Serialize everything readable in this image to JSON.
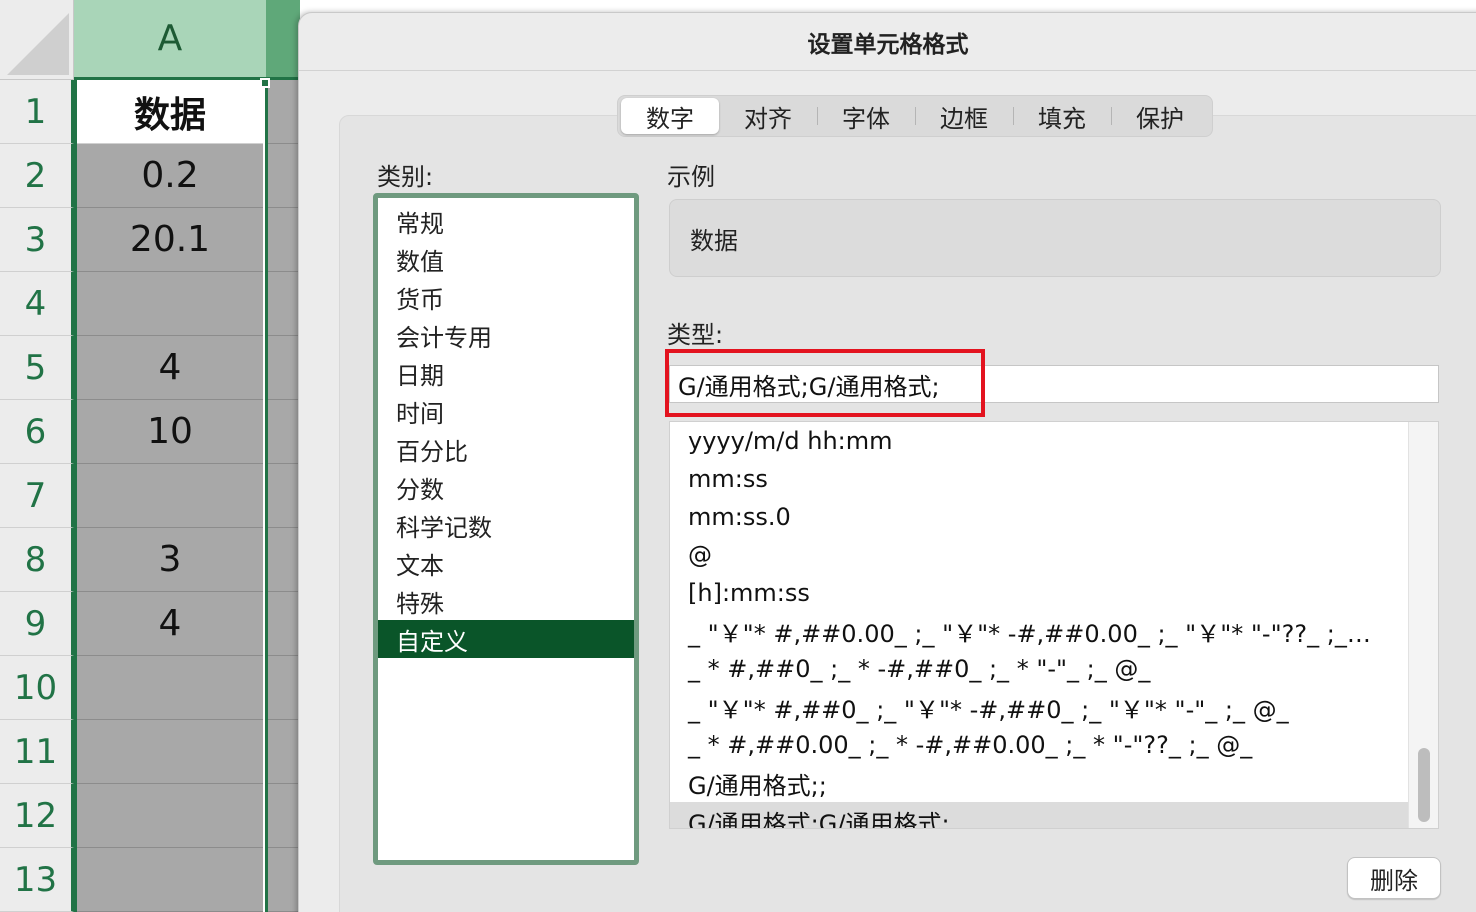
{
  "sheet": {
    "column_header": "A",
    "rows": [
      {
        "num": "1",
        "value": "数据"
      },
      {
        "num": "2",
        "value": "0.2"
      },
      {
        "num": "3",
        "value": "20.1"
      },
      {
        "num": "4",
        "value": ""
      },
      {
        "num": "5",
        "value": "4"
      },
      {
        "num": "6",
        "value": "10"
      },
      {
        "num": "7",
        "value": ""
      },
      {
        "num": "8",
        "value": "3"
      },
      {
        "num": "9",
        "value": "4"
      },
      {
        "num": "10",
        "value": ""
      },
      {
        "num": "11",
        "value": ""
      },
      {
        "num": "12",
        "value": ""
      },
      {
        "num": "13",
        "value": ""
      }
    ]
  },
  "dialog": {
    "title": "设置单元格格式",
    "tabs": [
      {
        "label": "数字",
        "selected": true
      },
      {
        "label": "对齐",
        "selected": false
      },
      {
        "label": "字体",
        "selected": false
      },
      {
        "label": "边框",
        "selected": false
      },
      {
        "label": "填充",
        "selected": false
      },
      {
        "label": "保护",
        "selected": false
      }
    ],
    "category_label": "类别:",
    "categories": [
      "常规",
      "数值",
      "货币",
      "会计专用",
      "日期",
      "时间",
      "百分比",
      "分数",
      "科学记数",
      "文本",
      "特殊",
      "自定义"
    ],
    "selected_category": "自定义",
    "sample_label": "示例",
    "sample_value": "数据",
    "type_label": "类型:",
    "type_value": "G/通用格式;G/通用格式;",
    "formats": [
      "yyyy/m/d hh:mm",
      "mm:ss",
      "mm:ss.0",
      "@",
      "[h]:mm:ss",
      "_ \"￥\"* #,##0.00_ ;_ \"￥\"* -#,##0.00_ ;_ \"￥\"* \"-\"??_ ;_…",
      "_ * #,##0_ ;_ * -#,##0_ ;_ * \"-\"_ ;_ @_",
      "_ \"￥\"* #,##0_ ;_ \"￥\"* -#,##0_ ;_ \"￥\"* \"-\"_ ;_ @_",
      "_ * #,##0.00_ ;_ * -#,##0.00_ ;_ * \"-\"??_ ;_ @_",
      "G/通用格式;;",
      "G/通用格式;G/通用格式;"
    ],
    "selected_format": "G/通用格式;G/通用格式;",
    "delete_label": "删除"
  },
  "colors": {
    "excel_green": "#217346",
    "selected_category_bg": "#0a5529",
    "highlight_red": "#e3131f"
  }
}
